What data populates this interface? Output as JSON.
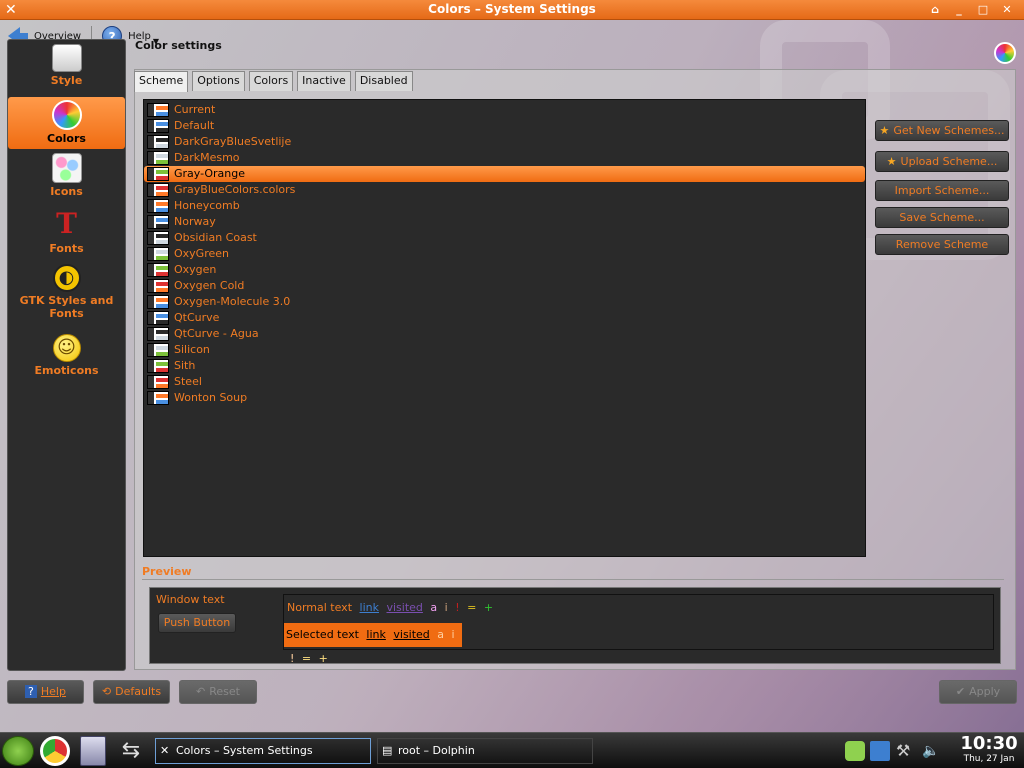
{
  "window": {
    "title": "Colors – System Settings"
  },
  "toolbar": {
    "overview_label": "Overview",
    "help_label": "Help"
  },
  "sidebar": {
    "items": [
      {
        "label": "Style"
      },
      {
        "label": "Colors"
      },
      {
        "label": "Icons"
      },
      {
        "label": "Fonts"
      },
      {
        "label": "GTK Styles and Fonts"
      },
      {
        "label": "Emoticons"
      }
    ],
    "active_index": 1
  },
  "main": {
    "heading": "Color settings",
    "tabs": [
      {
        "label": "Scheme"
      },
      {
        "label": "Options"
      },
      {
        "label": "Colors"
      },
      {
        "label": "Inactive"
      },
      {
        "label": "Disabled"
      }
    ],
    "active_tab": 0
  },
  "schemes": {
    "items": [
      {
        "name": "Current"
      },
      {
        "name": "Default"
      },
      {
        "name": "DarkGrayBlueSvetlije"
      },
      {
        "name": "DarkMesmo"
      },
      {
        "name": "Gray-Orange"
      },
      {
        "name": "GrayBlueColors.colors"
      },
      {
        "name": "Honeycomb"
      },
      {
        "name": "Norway"
      },
      {
        "name": "Obsidian Coast"
      },
      {
        "name": "OxyGreen"
      },
      {
        "name": "Oxygen"
      },
      {
        "name": "Oxygen Cold"
      },
      {
        "name": "Oxygen-Molecule 3.0"
      },
      {
        "name": "QtCurve"
      },
      {
        "name": "QtCurve - Agua"
      },
      {
        "name": "Silicon"
      },
      {
        "name": "Sith"
      },
      {
        "name": "Steel"
      },
      {
        "name": "Wonton Soup"
      }
    ],
    "selected": "Gray-Orange"
  },
  "actions": {
    "get_new": "Get New Schemes...",
    "upload": "Upload Scheme...",
    "import": "Import Scheme...",
    "save": "Save Scheme...",
    "remove": "Remove Scheme"
  },
  "preview": {
    "label": "Preview",
    "window_text": "Window text",
    "push_button": "Push Button",
    "normal_text": "Normal text",
    "link": "link",
    "visited": "visited",
    "normal_extras": [
      "a",
      "i",
      "!",
      "=",
      "+"
    ],
    "selected_text": "Selected text",
    "selected_extras": [
      "a",
      "i",
      "!",
      "=",
      "+"
    ]
  },
  "bottom": {
    "help": "Help",
    "defaults": "Defaults",
    "reset": "Reset",
    "apply": "Apply"
  },
  "taskbar": {
    "tasks": [
      {
        "label": "Colors – System Settings"
      },
      {
        "label": "root – Dolphin"
      }
    ],
    "clock_time": "10:30",
    "clock_date": "Thu, 27 Jan"
  },
  "colors": {
    "accent": "#f07c24",
    "selection": "#f06c12",
    "list_bg": "#2a2a2a"
  }
}
